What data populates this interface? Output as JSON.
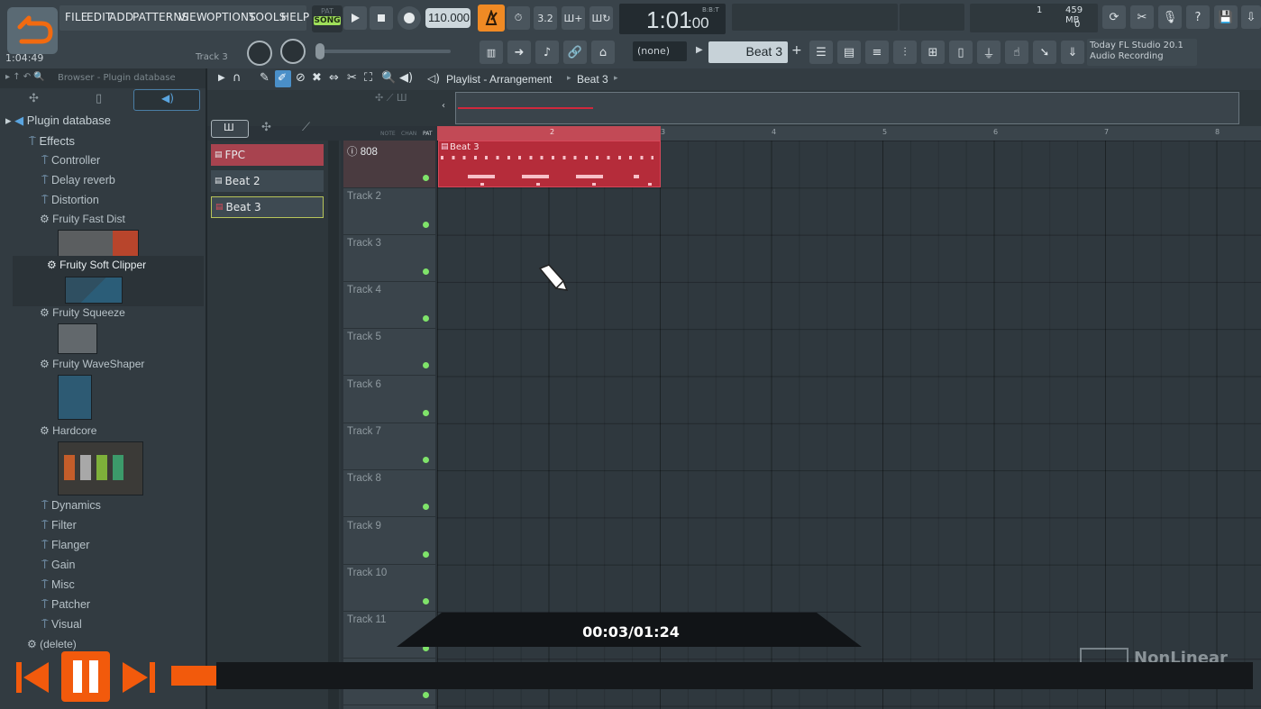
{
  "menu": [
    "FILE",
    "EDIT",
    "ADD",
    "PATTERNS",
    "VIEW",
    "OPTIONS",
    "TOOLS",
    "HELP"
  ],
  "transport": {
    "pat_label": "PAT",
    "song_label": "SONG",
    "tempo": "110.000",
    "time": "1:01",
    "time_small": ":00",
    "bst_label": "B:B:T",
    "elapsed": "1:04:49",
    "track_hint": "Track 3"
  },
  "cpu": {
    "value": "1",
    "memory": "459 MB",
    "voices": "0"
  },
  "pattern_selector": {
    "none_label": "(none)",
    "current": "Beat 3"
  },
  "news": {
    "line1": "Today  FL Studio 20.1",
    "line2": "Audio Recording"
  },
  "browser": {
    "header": "Browser - Plugin database",
    "root": "Plugin database",
    "effects": "Effects",
    "items": [
      "Controller",
      "Delay reverb",
      "Distortion"
    ],
    "plugins": [
      "Fruity Fast Dist",
      "Fruity Soft Clipper",
      "Fruity Squeeze",
      "Fruity WaveShaper",
      "Hardcore"
    ],
    "more": [
      "Dynamics",
      "Filter",
      "Flanger",
      "Gain",
      "Misc",
      "Patcher",
      "Visual"
    ],
    "delete": "(delete)"
  },
  "patterns": [
    "FPC",
    "Beat 2",
    "Beat 3"
  ],
  "playlist": {
    "title": "Playlist - Arrangement",
    "crumb": "Beat 3",
    "col_labels": [
      "NOTE",
      "CHAN",
      "PAT"
    ],
    "tracks": [
      "808",
      "Track 2",
      "Track 3",
      "Track 4",
      "Track 5",
      "Track 6",
      "Track 7",
      "Track 8",
      "Track 9",
      "Track 10",
      "Track 11"
    ],
    "bar_numbers": [
      "2",
      "3",
      "4",
      "5",
      "6",
      "7",
      "8"
    ],
    "clip_label": "Beat 3"
  },
  "video": {
    "timecode": "00:03/01:24",
    "watermark": "NonLinear"
  },
  "colors": {
    "accent": "#f08a24",
    "clip": "#b52c3a",
    "active_green": "#7fe36a",
    "player_orange": "#f25a0c"
  }
}
